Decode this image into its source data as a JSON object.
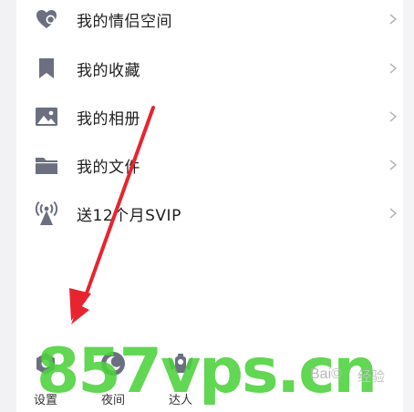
{
  "menu": {
    "items": [
      {
        "label": "我的情侣空间",
        "icon": "heart-icon"
      },
      {
        "label": "我的收藏",
        "icon": "bookmark-icon"
      },
      {
        "label": "我的相册",
        "icon": "photo-icon"
      },
      {
        "label": "我的文件",
        "icon": "folder-icon"
      },
      {
        "label": "送12个月SVIP",
        "icon": "broadcast-icon"
      }
    ]
  },
  "bottom_bar": {
    "settings_label": "设置",
    "night_label": "夜间",
    "expert_label": "达人"
  },
  "watermark": {
    "main_text": "857vps.cn",
    "baidu_text": "Bai©",
    "jingyan_text": "经验"
  },
  "colors": {
    "icon_gray": "#6b6f80",
    "arrow_red": "#e8242e",
    "watermark_green": "#4cd23c",
    "rail_bg": "#f2f2f4"
  }
}
